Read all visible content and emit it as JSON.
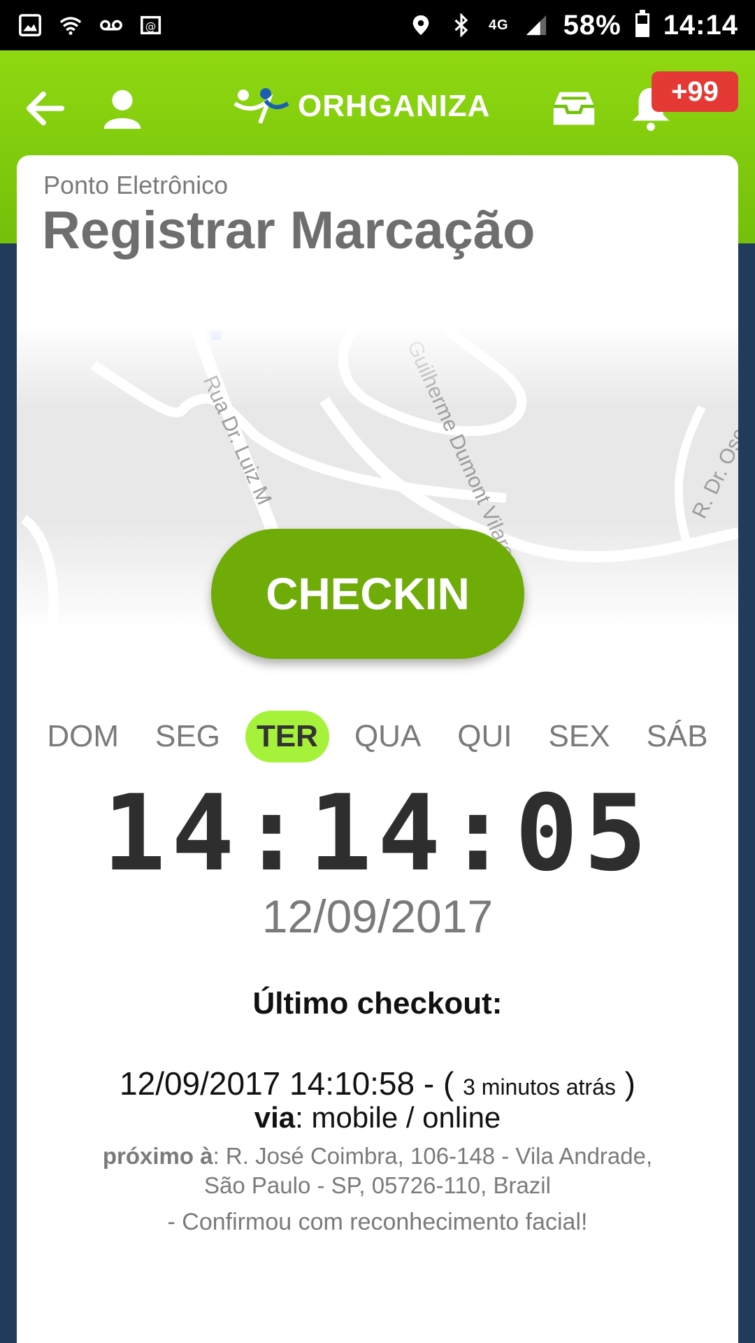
{
  "status_bar": {
    "battery": "58%",
    "time": "14:14",
    "network": "4G",
    "icons": [
      "image-icon",
      "wifi-icon",
      "voicemail-icon",
      "email-icon",
      "location-icon",
      "bluetooth-icon",
      "signal-icon",
      "battery-icon"
    ],
    "battery_level": 0.58
  },
  "header": {
    "logo_text": "ORHGANIZA",
    "notification_badge": "+99",
    "icons": [
      "back-arrow-icon",
      "user-icon",
      "inbox-icon",
      "bell-icon"
    ]
  },
  "page": {
    "subtitle": "Ponto Eletrônico",
    "title": "Registrar Marcação"
  },
  "map": {
    "streets": [
      "Rua Dr. Luiz M",
      "Guilherme Dumont Vilares",
      "R. Dr. Osc"
    ]
  },
  "checkin_label": "CHECKIN",
  "weekdays": {
    "days": [
      "DOM",
      "SEG",
      "TER",
      "QUA",
      "QUI",
      "SEX",
      "SÁB"
    ],
    "active": "TER"
  },
  "clock": {
    "time": "14:14:05",
    "date": "12/09/2017"
  },
  "last_checkout": {
    "label": "Último checkout:",
    "datetime": "12/09/2017 14:10:58",
    "relative": "3 minutos atrás",
    "via_label": "via",
    "via_value": "mobile / online",
    "near_label": "próximo à",
    "address": "R. José Coimbra, 106-148 - Vila Andrade, São Paulo - SP, 05726-110, Brazil",
    "facial_note": "- Confirmou com reconhecimento facial!"
  },
  "colors": {
    "header_green": "#8fd811",
    "button_green": "#6fac08",
    "active_day": "#a6f23a",
    "badge_red": "#e53935",
    "background_navy": "#213c5a"
  }
}
